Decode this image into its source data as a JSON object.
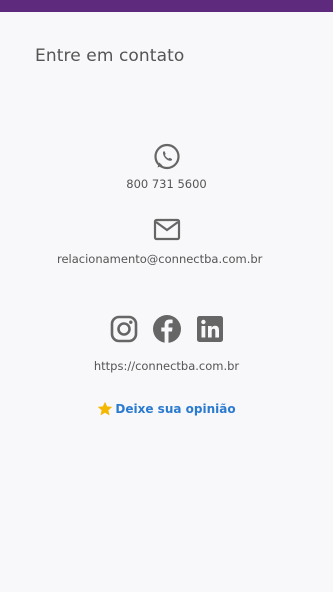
{
  "page": {
    "title": "Entre em contato",
    "accent_color": "#5d2a7e",
    "link_color": "#2a7bd0"
  },
  "contact": {
    "whatsapp_icon": "whatsapp-icon",
    "phone": "800 731 5600",
    "email_icon": "mail-icon",
    "email": "relacionamento@connectba.com.br",
    "social_icons": [
      "instagram-icon",
      "facebook-icon",
      "linkedin-icon"
    ],
    "website": "https://connectba.com.br"
  },
  "feedback": {
    "icon": "star-icon",
    "label": "Deixe sua opinião",
    "star_color": "#f5b800"
  }
}
